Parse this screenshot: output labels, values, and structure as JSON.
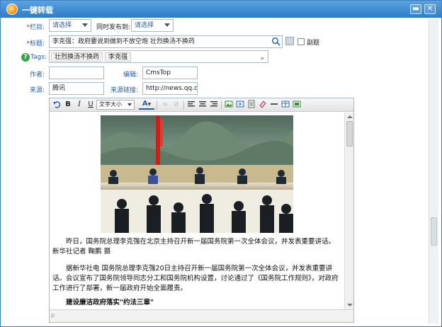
{
  "window": {
    "title": "一键转载",
    "minimize_glyph": "▬",
    "close_glyph": "✕"
  },
  "form": {
    "column": {
      "label": "栏目:",
      "required_mark": "*",
      "value": "请选择"
    },
    "publish_to": {
      "label": "同时发布到:",
      "value": "请选择"
    },
    "title": {
      "label": "标题:",
      "required_mark": "*",
      "value": "李克强：政府要说到做到不放空炮 壮烈换汤不换药",
      "subtitle_label": "副题"
    },
    "tags": {
      "label": "Tags:",
      "chips": [
        "壮烈换汤不换药",
        "李克强"
      ]
    },
    "author": {
      "label": "作者:",
      "value": ""
    },
    "editor": {
      "label": "编辑:",
      "value": "CmsTop"
    },
    "source": {
      "label": "来源:",
      "value": "腾讯"
    },
    "source_link": {
      "label": "来源链接:",
      "value": "http://news.qq.com"
    }
  },
  "toolbar": {
    "bold": "B",
    "italic": "I",
    "underline": "U",
    "font_size_label": "文字大小",
    "font_color": "A"
  },
  "article": {
    "caption": "昨日，国务院总理李克强在北京主持召开新一届国务院第一次全体会议，并发表重要讲话。新华社记者 鞠鹏 摄",
    "body": "据新华社电 国务院总理李克强20日主持召开新一届国务院第一次全体会议，并发表重要讲话。会议宣布了国务院领导同志分工和国务院机构设置，讨论通过了《国务院工作规则》，对政府工作进行了部署，新一届政府开始全面履责。",
    "heading": "建设廉洁政府落实\"约法三章\""
  },
  "statusbar": {
    "path": "p"
  },
  "icons": [
    "app-logo-icon",
    "minimize-icon",
    "close-icon",
    "search-icon",
    "help-icon",
    "undo-icon",
    "align-left-icon",
    "align-center-icon",
    "align-right-icon",
    "image-icon",
    "table-icon",
    "link-icon"
  ],
  "colors": {
    "titlebar": "#2f7cc8",
    "label_blue": "#2a5fa6",
    "required_red": "#e02020",
    "help_green": "#3aa34a"
  }
}
